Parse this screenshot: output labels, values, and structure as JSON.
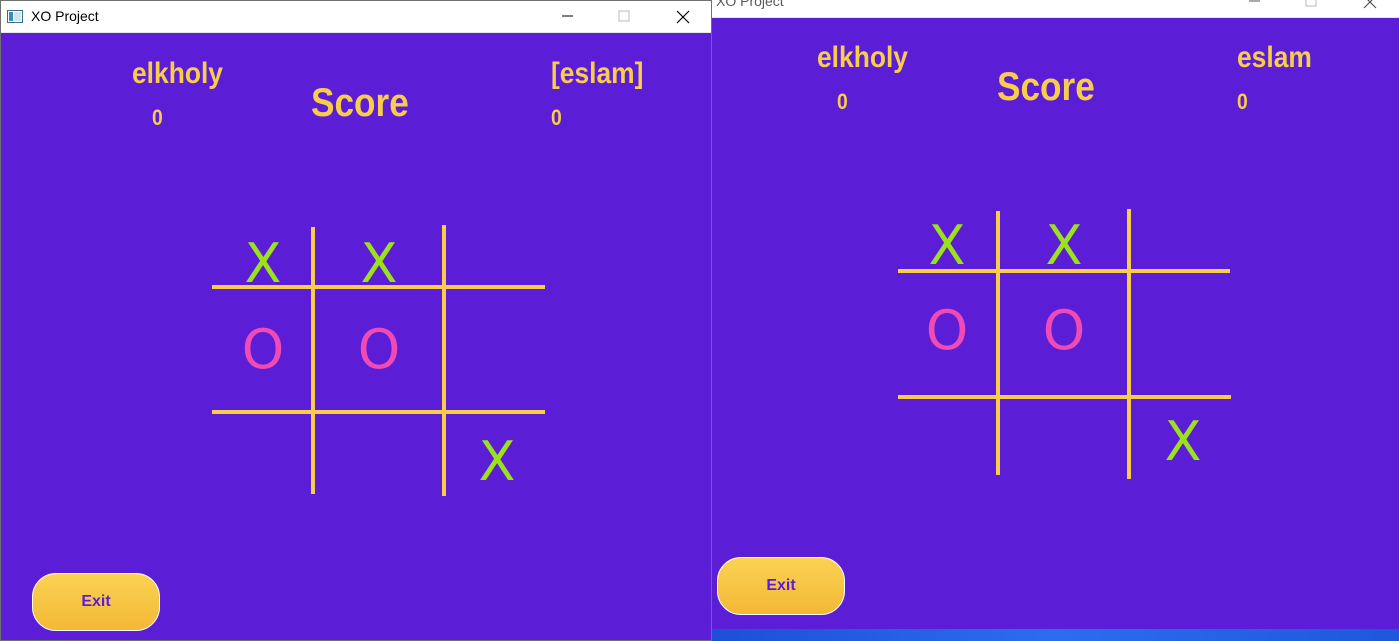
{
  "colors": {
    "background": "#5b1ed6",
    "accent_yellow": "#f7cd4a",
    "x_color": "#9be21c",
    "o_color": "#f04bb5"
  },
  "windows": [
    {
      "title": "XO Project",
      "player1": {
        "name": "elkholy",
        "score": "0"
      },
      "player2": {
        "name": "[eslam]",
        "score": "0"
      },
      "score_label": "Score",
      "board": [
        "X",
        "X",
        "",
        "O",
        "O",
        "",
        "",
        "",
        "X"
      ],
      "exit_label": "Exit"
    },
    {
      "title": "XO Project",
      "player1": {
        "name": "elkholy",
        "score": "0"
      },
      "player2": {
        "name": "eslam",
        "score": "0"
      },
      "score_label": "Score",
      "board": [
        "X",
        "X",
        "",
        "O",
        "O",
        "",
        "",
        "",
        "X"
      ],
      "exit_label": "Exit"
    }
  ]
}
